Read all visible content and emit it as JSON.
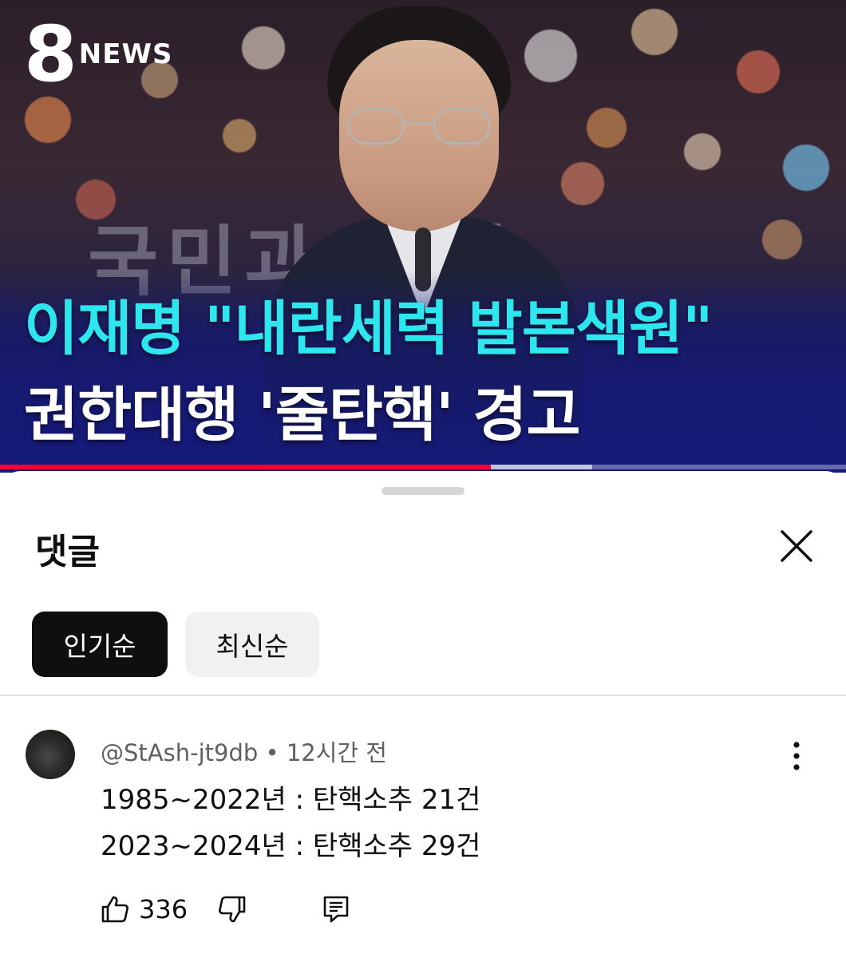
{
  "video": {
    "channel_logo_number": "8",
    "channel_logo_text": "NEWS",
    "background_text": "국민과 함께",
    "headline_line1": "이재명 \"내란세력 발본색원\"",
    "headline_line2": "권한대행 '줄탄핵' 경고",
    "headline_line1_color": "#2ee6ee",
    "headline_line2_color": "#ffffff",
    "progress_played": 0.58,
    "progress_buffered": 0.7,
    "progress_color": "#ff0033"
  },
  "comments_panel": {
    "title": "댓글",
    "close_icon": "close-icon",
    "sort_chips": [
      {
        "label": "인기순",
        "selected": true
      },
      {
        "label": "최신순",
        "selected": false
      }
    ],
    "comments": [
      {
        "author": "@StAsh-jt9db",
        "separator": "•",
        "time": "12시간 전",
        "lines": [
          "1985~2022년 : 탄핵소추 21건",
          "2023~2024년 : 탄핵소추 29건"
        ],
        "like_count": "336",
        "icons": [
          "thumbs-up-icon",
          "thumbs-down-icon",
          "reply-icon",
          "more-vertical-icon"
        ]
      }
    ]
  }
}
